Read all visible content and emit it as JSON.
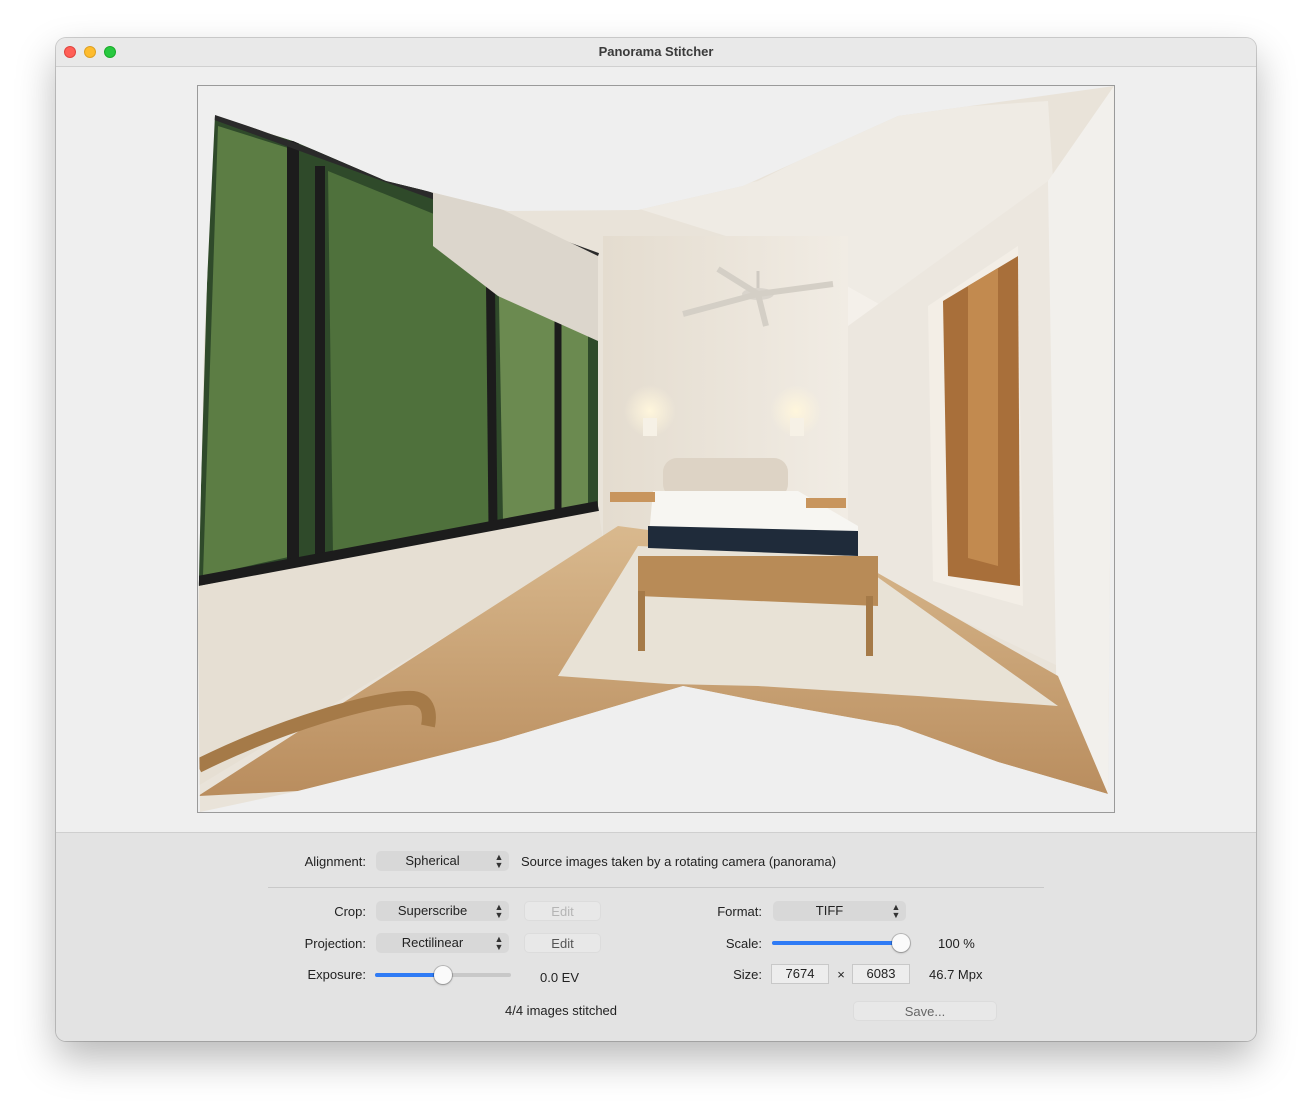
{
  "window": {
    "title": "Panorama Stitcher"
  },
  "controls": {
    "alignment": {
      "label": "Alignment:",
      "value": "Spherical",
      "description": "Source images taken by a rotating camera (panorama)"
    },
    "crop": {
      "label": "Crop:",
      "value": "Superscribe",
      "edit_label": "Edit"
    },
    "projection": {
      "label": "Projection:",
      "value": "Rectilinear",
      "edit_label": "Edit"
    },
    "exposure": {
      "label": "Exposure:",
      "value_text": "0.0 EV",
      "level": 0.5
    },
    "format": {
      "label": "Format:",
      "value": "TIFF"
    },
    "scale": {
      "label": "Scale:",
      "value_text": "100 %",
      "level": 1.0
    },
    "size": {
      "label": "Size:",
      "width": "7674",
      "separator": "×",
      "height": "6083",
      "megapixels": "46.7 Mpx"
    },
    "status": "4/4 images stitched",
    "save_label": "Save..."
  },
  "colors": {
    "accent": "#2f7bf5",
    "close": "#ff5f57",
    "minimize": "#febc2e",
    "maximize": "#28c840"
  }
}
